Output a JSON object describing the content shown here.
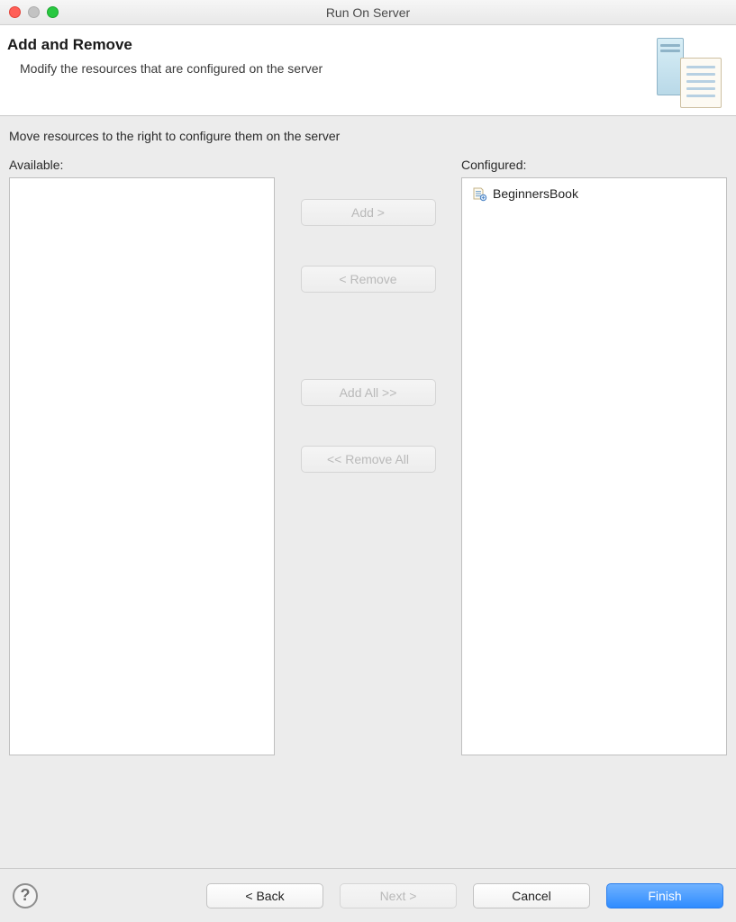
{
  "window": {
    "title": "Run On Server"
  },
  "header": {
    "title": "Add and Remove",
    "subtitle": "Modify the resources that are configured on the server"
  },
  "instruction": "Move resources to the right to configure them on the server",
  "available": {
    "label": "Available:",
    "items": []
  },
  "configured": {
    "label": "Configured:",
    "items": [
      {
        "name": "BeginnersBook"
      }
    ]
  },
  "transfer": {
    "add": "Add >",
    "remove": "< Remove",
    "addAll": "Add All >>",
    "removeAll": "<< Remove All"
  },
  "footer": {
    "back": "< Back",
    "next": "Next >",
    "cancel": "Cancel",
    "finish": "Finish"
  }
}
